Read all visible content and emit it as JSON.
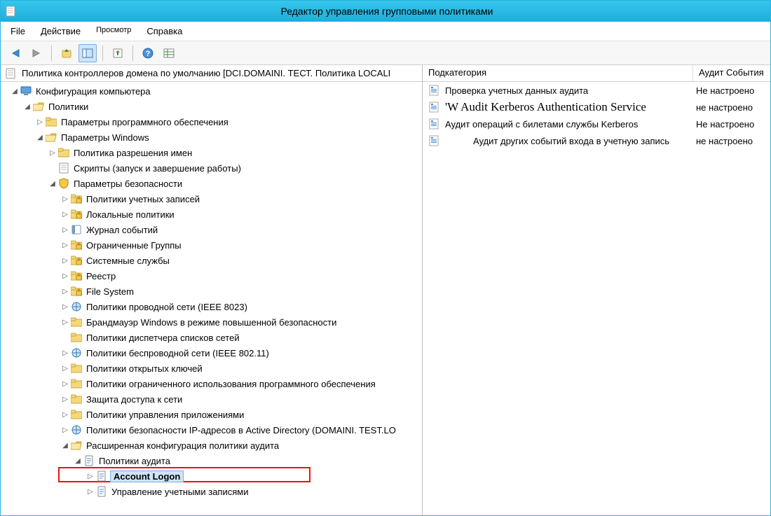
{
  "window": {
    "title": "Редактор управления групповыми политиками"
  },
  "menu": {
    "file": "File",
    "action": "Действие",
    "view": "Просмотр",
    "help": "Справка"
  },
  "left_header": "Политика контроллеров домена по умолчанию [DCI.DOMAINI. ТЕСТ. Политика LOCALI",
  "tree": {
    "root": "Конфигурация компьютера",
    "policies": "Политики",
    "sw": "Параметры программного обеспечения",
    "win": "Параметры Windows",
    "nameres": "Политика разрешения имен",
    "scripts": "Скрипты (запуск и завершение работы)",
    "sec": "Параметры безопасности",
    "acct": "Политики учетных записей",
    "local": "Локальные политики",
    "evlog": "Журнал событий",
    "rgrp": "Ограниченные Группы",
    "svc": "Системные службы",
    "reg": "Реестр",
    "fs": "File System",
    "wired": "Политики проводной сети (IEEE 8023)",
    "fw": "Брандмауэр Windows в режиме повышенной безопасности",
    "nlm": "Политики диспетчера списков сетей",
    "wlan": "Политики беспроводной сети (IEEE 802.11)",
    "pki": "Политики открытых ключей",
    "srp": "Политики ограниченного использования программного обеспечения",
    "nap": "Защита доступа к сети",
    "appctrl": "Политики управления приложениями",
    "ipsec": "Политики безопасности IP-адресов в Active Directory (DOMAINI. TEST.LO",
    "advaudit": "Расширенная конфигурация политики аудита",
    "auditpol": "Политики аудита",
    "acctlogon": "Account Logon",
    "acctmgmt": "Управление учетными записями"
  },
  "columns": {
    "sub": "Подкатегория",
    "audit": "Аудит События"
  },
  "rows": [
    {
      "name": "Проверка учетных данных аудита",
      "audit": "Не настроено",
      "big": false
    },
    {
      "name": "'W Audit Kerberos Authentication Service",
      "audit": "не настроено",
      "big": true
    },
    {
      "name": "Аудит операций с билетами службы Kerberos",
      "audit": "Не настроено",
      "big": false
    },
    {
      "name": "Аудит других событий входа в учетную запись",
      "audit": "не настроено",
      "big": false
    }
  ]
}
